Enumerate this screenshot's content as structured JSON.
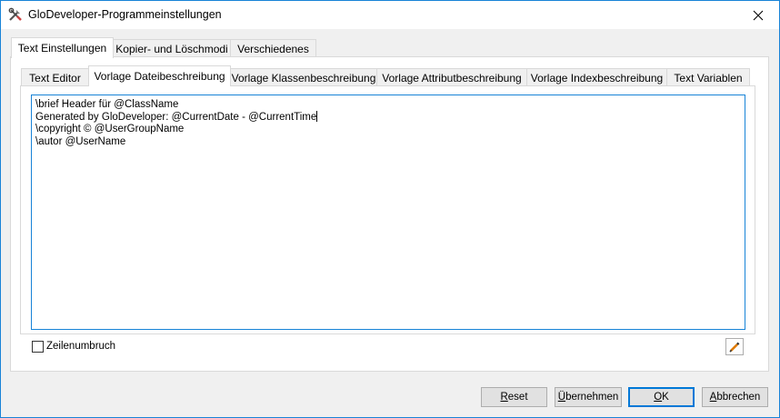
{
  "window": {
    "title": "GloDeveloper-Programmeinstellungen",
    "accent_color": "#1883d7"
  },
  "outer_tabs": [
    {
      "label": "Text Einstellungen",
      "active": true
    },
    {
      "label": "Kopier- und Löschmodi",
      "active": false
    },
    {
      "label": "Verschiedenes",
      "active": false
    }
  ],
  "inner_tabs": [
    {
      "label": "Text Editor",
      "active": false
    },
    {
      "label": "Vorlage Dateibeschreibung",
      "active": true
    },
    {
      "label": "Vorlage Klassenbeschreibung",
      "active": false
    },
    {
      "label": "Vorlage Attributbeschreibung",
      "active": false
    },
    {
      "label": "Vorlage Indexbeschreibung",
      "active": false
    },
    {
      "label": "Text Variablen",
      "active": false
    }
  ],
  "editor": {
    "lines": [
      "\\brief Header für @ClassName",
      "Generated by GloDeveloper: @CurrentDate - @CurrentTime",
      "\\copyright © @UserGroupName",
      "\\autor @UserName"
    ]
  },
  "options": {
    "word_wrap_label": "Zeilenumbruch",
    "word_wrap_checked": false
  },
  "buttons": {
    "reset": {
      "label": "Reset",
      "accel_index": 0
    },
    "apply": {
      "label": "Übernehmen",
      "accel_index": 0
    },
    "ok": {
      "label": "OK",
      "accel_index": 0
    },
    "cancel": {
      "label": "Abbrechen",
      "accel_index": 0
    }
  }
}
